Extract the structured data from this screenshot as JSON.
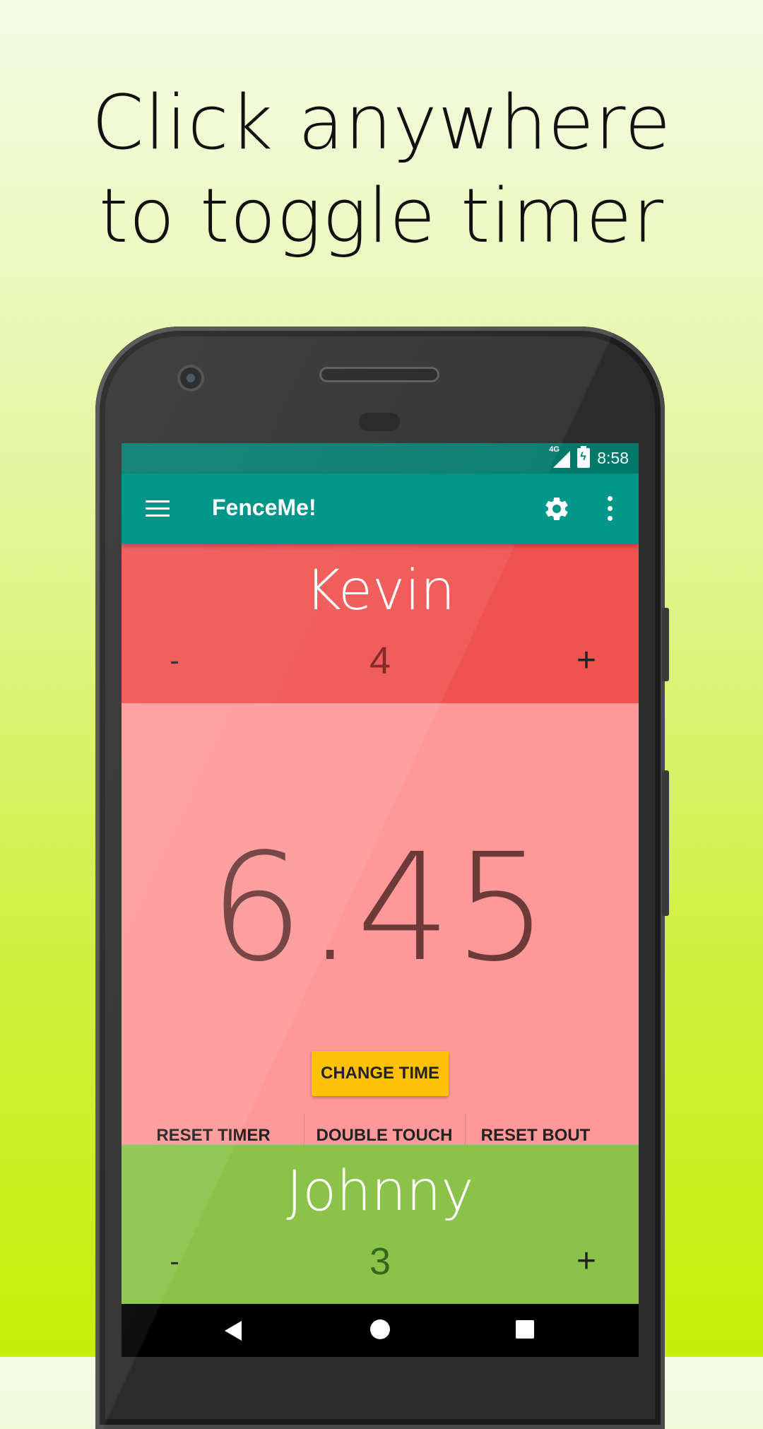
{
  "headline": {
    "line1": "Click anywhere",
    "line2": "to toggle timer"
  },
  "status_bar": {
    "network": "4G",
    "time": "8:58"
  },
  "app_bar": {
    "title": "FenceMe!",
    "icons": [
      "menu-icon",
      "gear-icon",
      "more-vert-icon"
    ]
  },
  "fencer_top": {
    "name": "Kevin",
    "score": "4",
    "minus_label": "-",
    "plus_label": "+",
    "color": "#ef5350"
  },
  "timer": {
    "value": "6.45",
    "change_time_label": "CHANGE TIME",
    "actions": [
      "RESET TIMER",
      "DOUBLE TOUCH",
      "RESET BOUT"
    ],
    "color": "#ff9999"
  },
  "fencer_bottom": {
    "name": "Johnny",
    "score": "3",
    "minus_label": "-",
    "plus_label": "+",
    "color": "#8bc34a"
  },
  "nav_bar": {
    "icons": [
      "back-icon",
      "home-icon",
      "recents-icon"
    ]
  },
  "colors": {
    "app_bar": "#009688",
    "status_bar": "#00796b",
    "accent_button": "#ffc107"
  }
}
